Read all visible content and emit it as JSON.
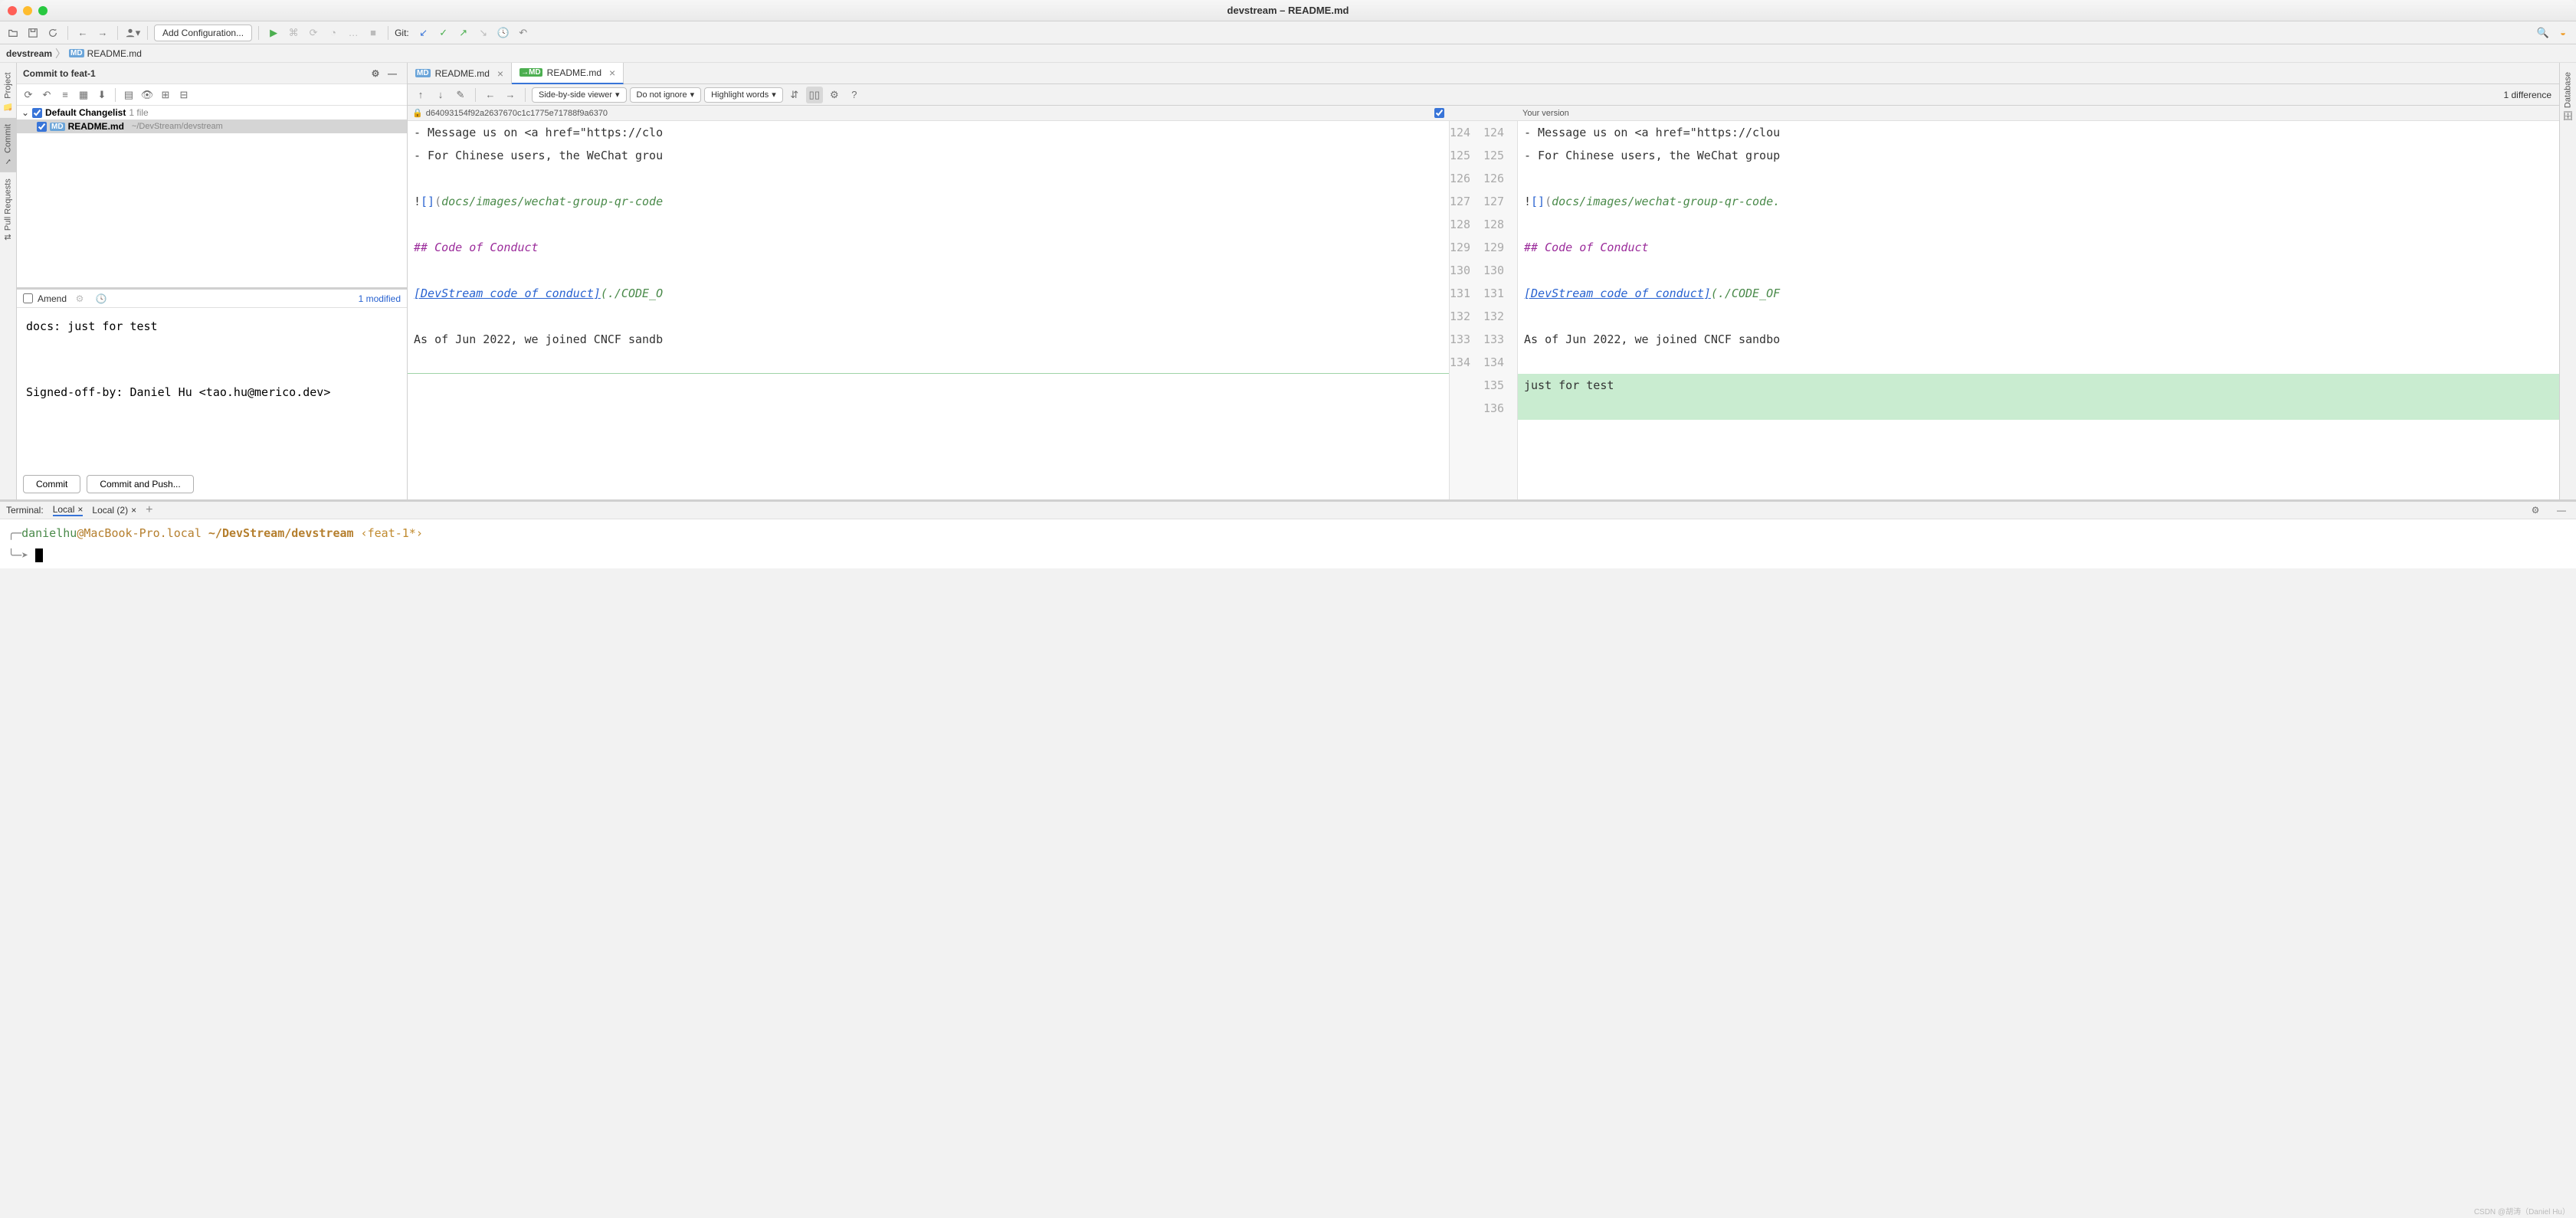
{
  "window": {
    "title": "devstream – README.md"
  },
  "breadcrumb": {
    "project": "devstream",
    "file": "README.md"
  },
  "toolbar": {
    "add_config": "Add Configuration...",
    "git_label": "Git:"
  },
  "left_tools": {
    "project": "Project",
    "commit": "Commit",
    "pull_requests": "Pull Requests"
  },
  "right_tools": {
    "database": "Database"
  },
  "commit_panel": {
    "title": "Commit to feat-1",
    "changelist_name": "Default Changelist",
    "changelist_count": "1 file",
    "file_name": "README.md",
    "file_path": "~/DevStream/devstream",
    "amend_label": "Amend",
    "modified_label": "1 modified",
    "message": "docs: just for test\n\n\nSigned-off-by: Daniel Hu <tao.hu@merico.dev>",
    "commit_btn": "Commit",
    "commit_push_btn": "Commit and Push..."
  },
  "editor": {
    "tabs": [
      {
        "name": "README.md",
        "active": false
      },
      {
        "name": "README.md",
        "active": true
      }
    ]
  },
  "diff": {
    "viewer_mode": "Side-by-side viewer",
    "ignore_mode": "Do not ignore",
    "highlight_mode": "Highlight words",
    "count": "1 difference",
    "revision": "d64093154f92a2637670c1c1775e71788f9a6370",
    "your_version": "Your version",
    "left_lines": {
      "124": "- Message us on <a href=\"https://clo",
      "125": "- For Chinese users, the WeChat grou",
      "126": "",
      "127_pre": "!",
      "127_brack": "[]",
      "127_paren": "(",
      "127_path": "docs/images/wechat-group-qr-code",
      "127_end": "",
      "128": "",
      "129": "## Code of Conduct",
      "130": "",
      "131_link": "[DevStream code of conduct]",
      "131_rest": "(./CODE_O",
      "132": "",
      "133": "As of Jun 2022, we joined CNCF sandb",
      "134": ""
    },
    "right_lines": {
      "124": "- Message us on <a href=\"https://clou",
      "125": "- For Chinese users, the WeChat group",
      "126": "",
      "127_pre": "!",
      "127_brack": "[]",
      "127_paren": "(",
      "127_path": "docs/images/wechat-group-qr-code.",
      "127_end": "",
      "128": "",
      "129": "## Code of Conduct",
      "130": "",
      "131_link": "[DevStream code of conduct]",
      "131_rest": "(./CODE_OF",
      "132": "",
      "133": "As of Jun 2022, we joined CNCF sandbo",
      "134": "",
      "135": "just for test",
      "136": ""
    },
    "gutter_left": [
      "124",
      "125",
      "126",
      "127",
      "128",
      "129",
      "130",
      "131",
      "132",
      "133",
      "134"
    ],
    "gutter_right": [
      "124",
      "125",
      "126",
      "127",
      "128",
      "129",
      "130",
      "131",
      "132",
      "133",
      "134",
      "135",
      "136"
    ]
  },
  "terminal": {
    "label": "Terminal:",
    "tab1": "Local",
    "tab2": "Local (2)",
    "user": "danielhu",
    "at": "@",
    "host": "MacBook-Pro.local",
    "path": "~/DevStream/devstream",
    "branch": "‹feat-1*›",
    "prompt_glyph": "╰─➤"
  },
  "watermark": "CSDN @胡涛（Daniel Hu）"
}
